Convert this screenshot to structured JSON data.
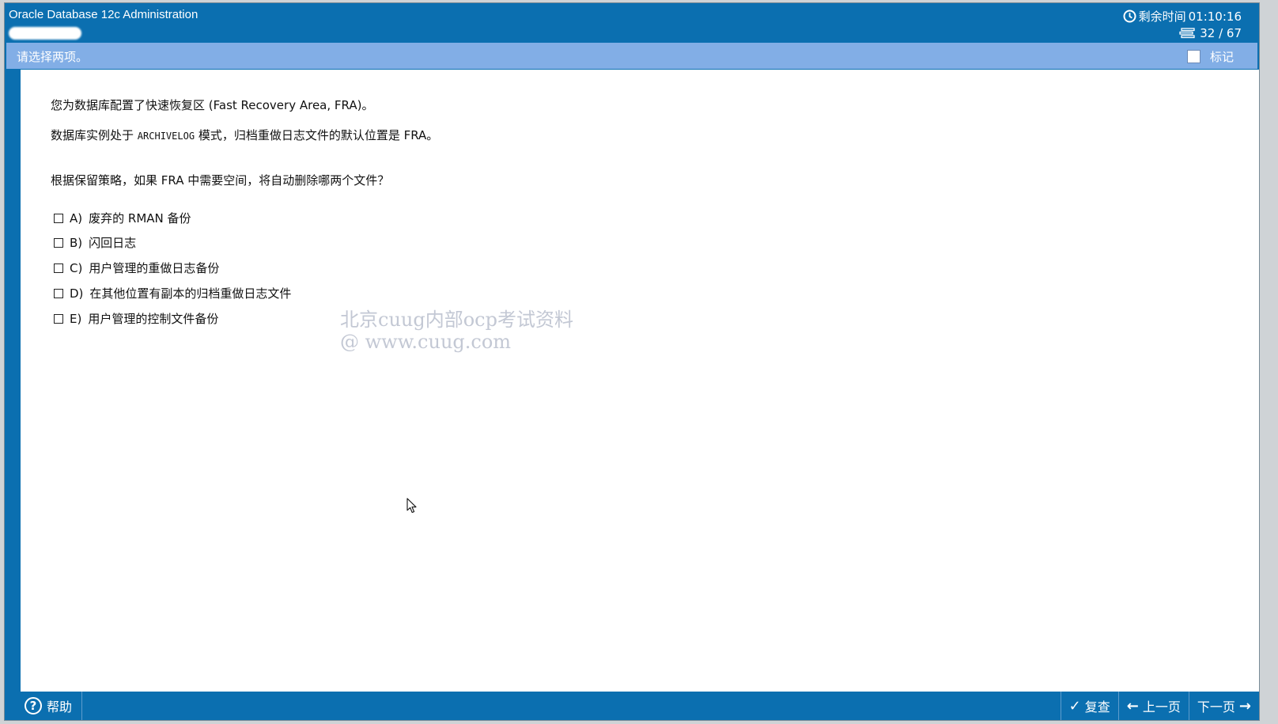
{
  "window": {
    "app_title": "Oracle Database 12c Administration",
    "timer_label": "剩余时间",
    "timer_value": "01:10:16",
    "progress": "32 / 67"
  },
  "instruction_bar": {
    "text": "请选择两项。",
    "mark_label": "标记"
  },
  "question": {
    "line1": "您为数据库配置了快速恢复区 (Fast Recovery Area, FRA)。",
    "line2_prefix": "数据库实例处于",
    "line2_code": "ARCHIVELOG",
    "line2_suffix": "模式，归档重做日志文件的默认位置是 FRA。",
    "line3": "根据保留策略，如果 FRA 中需要空间，将自动删除哪两个文件？"
  },
  "options": [
    {
      "letter": "A)",
      "text": "废弃的 RMAN 备份"
    },
    {
      "letter": "B)",
      "text": "闪回日志"
    },
    {
      "letter": "C)",
      "text": "用户管理的重做日志备份"
    },
    {
      "letter": "D)",
      "text": "在其他位置有副本的归档重做日志文件"
    },
    {
      "letter": "E)",
      "text": "用户管理的控制文件备份"
    }
  ],
  "watermark": {
    "line1": "北京cuug内部ocp考试资料",
    "line2": "@ www.cuug.com"
  },
  "bottombar": {
    "help_label": "帮助",
    "review_label": "复查",
    "prev_label": "上一页",
    "next_label": "下一页"
  },
  "colors": {
    "primary": "#0b6fb0",
    "instruction_bar": "#82aee6"
  },
  "icons": {
    "timer": "clock-icon",
    "progress": "stack-icon",
    "help": "help-icon",
    "review": "check-icon",
    "prev": "arrow-left-icon",
    "next": "arrow-right-icon"
  }
}
